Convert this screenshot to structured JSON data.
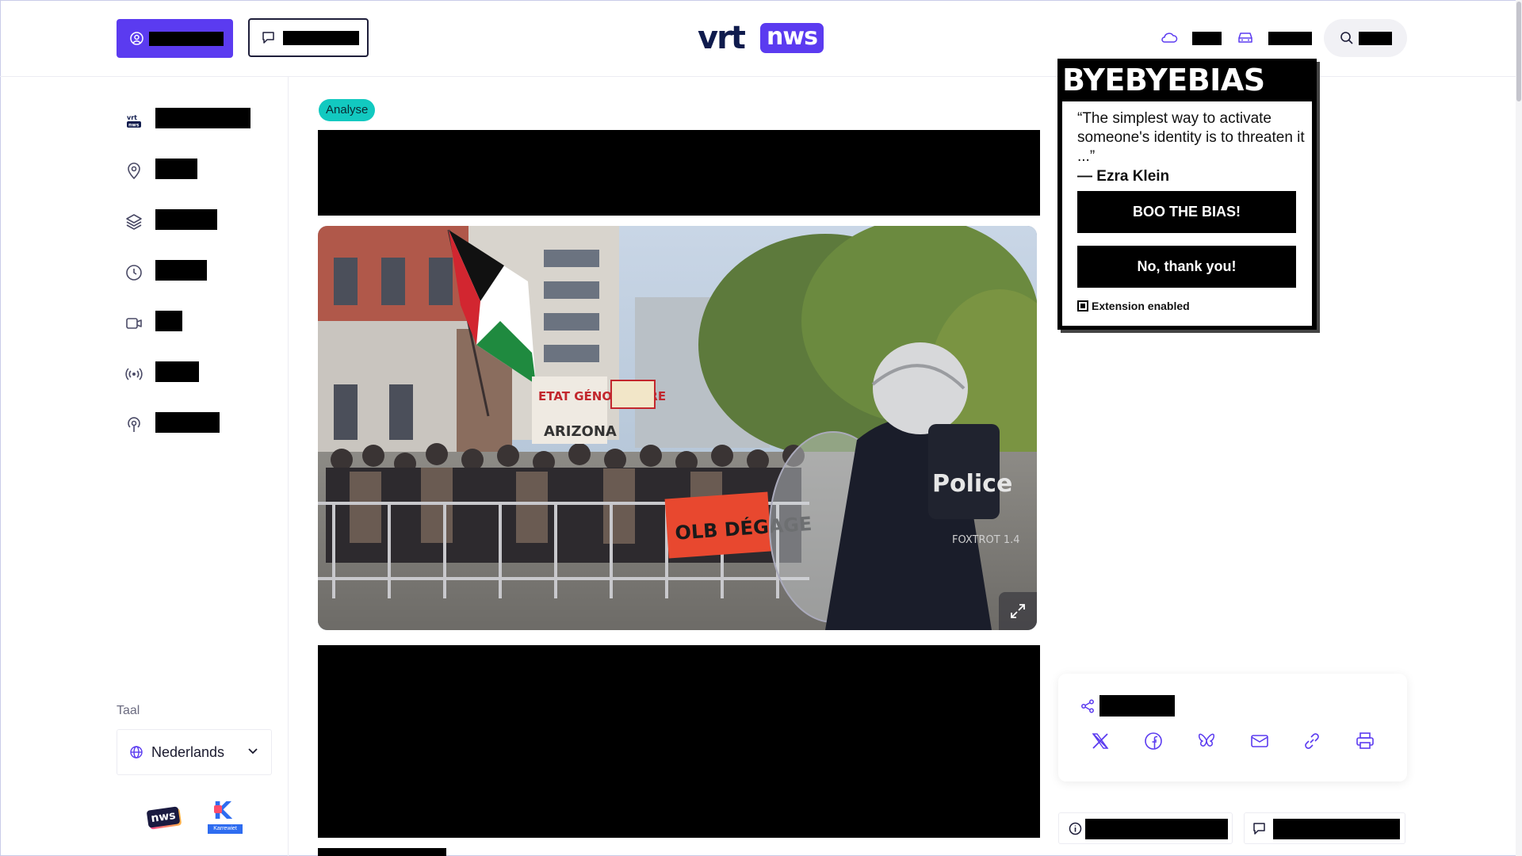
{
  "header": {
    "logo_vrt": "vrt",
    "logo_nws": "nws"
  },
  "sidebar": {
    "items": [
      {
        "icon": "vrt-nws-icon"
      },
      {
        "icon": "location-pin-icon"
      },
      {
        "icon": "layers-icon"
      },
      {
        "icon": "clock-icon"
      },
      {
        "icon": "video-icon"
      },
      {
        "icon": "broadcast-icon"
      },
      {
        "icon": "podcast-icon"
      }
    ],
    "language_label": "Taal",
    "language_value": "Nederlands",
    "partner_nws": "nws",
    "partner_ketnet": "Karrewiet"
  },
  "article": {
    "tag": "Analyse",
    "photo_texts": {
      "flag_sign": "ETAT GÉNOCIDAIRE",
      "arizona_sign": "ARIZONA",
      "banner": "OLB DÉGAGE",
      "police_back": "Police",
      "police_id": "FOXTROT 1.4"
    }
  },
  "popup": {
    "title": "BYEBYEBIAS",
    "quote": "“The simplest way to activate someone's identity is to threaten it ...”",
    "author": "— Ezra Klein",
    "primary_button": "BOO THE BIAS!",
    "secondary_button": "No, thank you!",
    "checkbox_label": "Extension enabled"
  },
  "share": {
    "icons": [
      "x-icon",
      "facebook-icon",
      "bluesky-icon",
      "mail-icon",
      "link-icon",
      "print-icon"
    ]
  },
  "colors": {
    "brand_purple": "#5b3bf0",
    "tag_teal": "#12c9c0",
    "navy": "#0f1b4d"
  }
}
